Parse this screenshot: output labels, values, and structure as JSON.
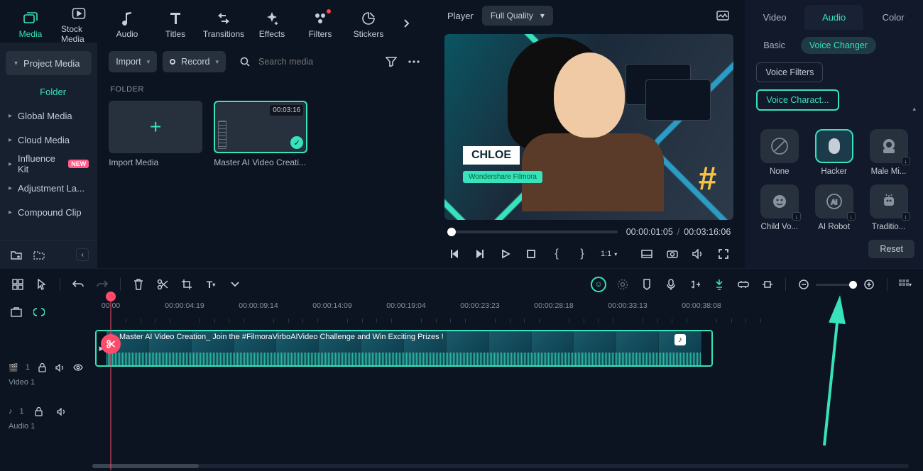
{
  "nav": {
    "tabs": [
      {
        "label": "Media",
        "icon": "image-stack"
      },
      {
        "label": "Stock Media",
        "icon": "play-box"
      },
      {
        "label": "Audio",
        "icon": "music-note"
      },
      {
        "label": "Titles",
        "icon": "letter-t"
      },
      {
        "label": "Transitions",
        "icon": "swap"
      },
      {
        "label": "Effects",
        "icon": "sparkle"
      },
      {
        "label": "Filters",
        "icon": "dots-filter"
      },
      {
        "label": "Stickers",
        "icon": "sticker"
      }
    ]
  },
  "sidebar": {
    "header": "Project Media",
    "folder": "Folder",
    "items": [
      "Global Media",
      "Cloud Media",
      "Influence Kit",
      "Adjustment La...",
      "Compound Clip"
    ],
    "new": "NEW"
  },
  "toolbar": {
    "import": "Import",
    "record": "Record",
    "search_ph": "Search media"
  },
  "content": {
    "folder_label": "FOLDER",
    "import_media": "Import Media",
    "clip_name": "Master AI Video Creati...",
    "clip_dur": "00:03:16"
  },
  "player": {
    "label": "Player",
    "quality": "Full Quality",
    "name_tag": "CHLOE",
    "brand": "Wondershare Filmora",
    "time_cur": "00:00:01:05",
    "time_total": "00:03:16:06",
    "ratio": "1:1"
  },
  "inspector": {
    "tabs": {
      "video": "Video",
      "audio": "Audio",
      "color": "Color"
    },
    "sub": {
      "basic": "Basic",
      "voice": "Voice Changer"
    },
    "filters": "Voice Filters",
    "character": "Voice Charact...",
    "voices": [
      {
        "label": "None",
        "icon": "none"
      },
      {
        "label": "Hacker",
        "icon": "mask",
        "selected": true
      },
      {
        "label": "Male Mi...",
        "icon": "robot",
        "dl": true
      },
      {
        "label": "Child Vo...",
        "icon": "child",
        "dl": true
      },
      {
        "label": "AI Robot",
        "icon": "ai",
        "dl": true
      },
      {
        "label": "Traditio...",
        "icon": "bot",
        "dl": true
      }
    ],
    "reset": "Reset"
  },
  "ruler": {
    "marks": [
      "00:00",
      "00:00:04:19",
      "00:00:09:14",
      "00:00:14:09",
      "00:00:19:04",
      "00:00:23:23",
      "00:00:28:18",
      "00:00:33:13",
      "00:00:38:08"
    ]
  },
  "tracks": {
    "video": {
      "label": "Video 1",
      "badge": "1"
    },
    "audio": {
      "label": "Audio 1",
      "badge": "1"
    },
    "clip_title": "Master AI Video Creation_ Join the #FilmoraVirboAIVideo Challenge and Win Exciting Prizes !"
  }
}
